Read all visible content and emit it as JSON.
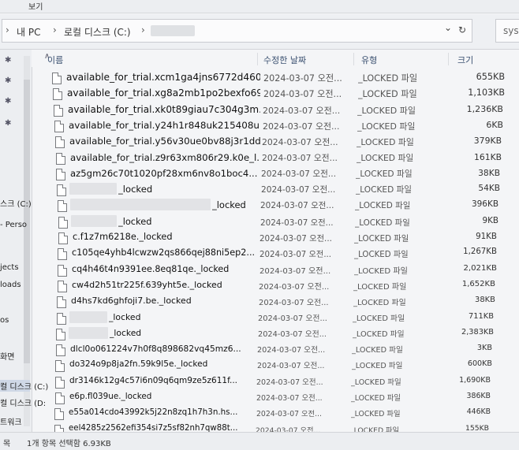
{
  "menu": {
    "items": [
      "보기"
    ]
  },
  "address": {
    "breadcrumbs": [
      "내 PC",
      "로컬 디스크 (C:)"
    ],
    "separator": "›",
    "refresh_icon": "↻",
    "dropdown_icon": "⌄",
    "search_placeholder": "sys"
  },
  "columns": {
    "name": "이름",
    "date": "수정한 날짜",
    "type": "유형",
    "size": "크기"
  },
  "sidebar": {
    "items": [
      {
        "label": "스크 (C:)",
        "selected": false
      },
      {
        "label": "- Perso",
        "selected": false
      },
      {
        "label": "jects",
        "selected": false
      },
      {
        "label": "loads",
        "selected": false
      },
      {
        "label": "os",
        "selected": false
      },
      {
        "label": "화면",
        "selected": false
      },
      {
        "label": "컬 디스크 (C:)",
        "selected": true
      },
      {
        "label": "컬 디스크 (D:",
        "selected": false
      },
      {
        "label": "트워크",
        "selected": false
      }
    ]
  },
  "files": [
    {
      "name": "available_for_trial.xcm1ga4jns6772d460...",
      "date": "2024-03-07 오전...",
      "type": "_LOCKED 파일",
      "size": "655KB"
    },
    {
      "name": "available_for_trial.xg8a2mb1po2bexfo69...",
      "date": "2024-03-07 오전...",
      "type": "_LOCKED 파일",
      "size": "1,103KB"
    },
    {
      "name": "available_for_trial.xk0t89giau7c304g3m...",
      "date": "2024-03-07 오전...",
      "type": "_LOCKED 파일",
      "size": "1,236KB"
    },
    {
      "name": "available_for_trial.y24h1r848uk215408u...",
      "date": "2024-03-07 오전...",
      "type": "_LOCKED 파일",
      "size": "6KB"
    },
    {
      "name": "available_for_trial.y56v30ue0bv88j3r1dd...",
      "date": "2024-03-07 오전...",
      "type": "_LOCKED 파일",
      "size": "379KB"
    },
    {
      "name": "available_for_trial.z9r63xm806r29.k0e_l...",
      "date": "2024-03-07 오전...",
      "type": "_LOCKED 파일",
      "size": "161KB"
    },
    {
      "name": "az5gm26c70t1020pf28xm6nv8o1boc4...",
      "date": "2024-03-07 오전...",
      "type": "_LOCKED 파일",
      "size": "38KB"
    },
    {
      "name": "_locked",
      "date": "2024-03-07 오전...",
      "type": "_LOCKED 파일",
      "size": "54KB"
    },
    {
      "name": "_locked",
      "date": "2024-03-07 오전...",
      "type": "_LOCKED 파일",
      "size": "396KB"
    },
    {
      "name": "_locked",
      "date": "2024-03-07 오전...",
      "type": "_LOCKED 파일",
      "size": "9KB"
    },
    {
      "name": "c.f1z7m6218e._locked",
      "date": "2024-03-07 오전...",
      "type": "_LOCKED 파일",
      "size": "91KB"
    },
    {
      "name": "c105qe4yhb4lcwzw2qs866qej88ni5ep2...",
      "date": "2024-03-07 오전...",
      "type": "_LOCKED 파일",
      "size": "1,267KB"
    },
    {
      "name": "cq4h46t4n9391ee.8eq81qe._locked",
      "date": "2024-03-07 오전...",
      "type": "_LOCKED 파일",
      "size": "2,021KB"
    },
    {
      "name": "cw4d2h51tr225f.639yht5e._locked",
      "date": "2024-03-07 오전...",
      "type": "_LOCKED 파일",
      "size": "1,652KB"
    },
    {
      "name": "d4hs7kd6ghfoji7.be._locked",
      "date": "2024-03-07 오전...",
      "type": "_LOCKED 파일",
      "size": "38KB"
    },
    {
      "name": "_locked",
      "date": "2024-03-07 오전...",
      "type": "_LOCKED 파일",
      "size": "711KB"
    },
    {
      "name": "_locked",
      "date": "2024-03-07 오전...",
      "type": "_LOCKED 파일",
      "size": "2,383KB"
    },
    {
      "name": "dlcl0o061224v7h0f8q898682vq45mz6...",
      "date": "2024-03-07 오전...",
      "type": "_LOCKED 파일",
      "size": "3KB"
    },
    {
      "name": "do324o9p8ja2fn.59k9l5e._locked",
      "date": "2024-03-07 오전...",
      "type": "_LOCKED 파일",
      "size": "600KB"
    },
    {
      "name": "dr3146k12g4c57i6n09q6qm9ze5z611f...",
      "date": "2024-03-07 오전...",
      "type": "_LOCKED 파일",
      "size": "1,690KB"
    },
    {
      "name": "e6p.fl039ue._locked",
      "date": "2024-03-07 오전...",
      "type": "_LOCKED 파일",
      "size": "386KB"
    },
    {
      "name": "e55a014cdo43992k5j22n8zq1h7h3n.hs...",
      "date": "2024-03-07 오전...",
      "type": "_LOCKED 파일",
      "size": "446KB"
    },
    {
      "name": "eel4285z2562efi354si7z5sf82nh7qw88t...",
      "date": "2024-03-07 오전...",
      "type": "_LOCKED 파일",
      "size": "155KB"
    }
  ],
  "status": {
    "count": "1개 항목 선택함 6.93KB",
    "left": "목"
  }
}
